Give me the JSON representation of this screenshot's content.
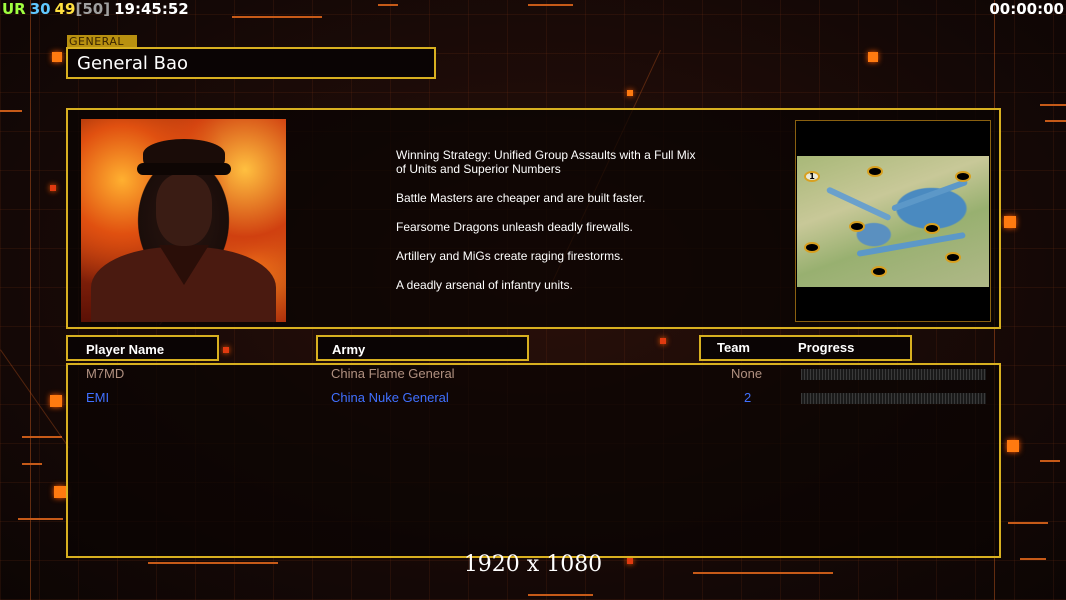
{
  "hud": {
    "left_parts": [
      {
        "text": "UR",
        "color": "#a0ff40"
      },
      {
        "text": "30",
        "color": "#60c8ff"
      },
      {
        "text": "49",
        "color": "#ffe040"
      },
      {
        "text": "[50]",
        "color": "#a0a0a0"
      },
      {
        "text": "19:45:52",
        "color": "#ffffff"
      }
    ],
    "timer": "00:00:00"
  },
  "general": {
    "tag": "GENERAL",
    "name": "General Bao"
  },
  "strategy_lines": [
    "Winning Strategy: Unified Group Assaults with a Full Mix of Units and Superior Numbers",
    "Battle Masters are cheaper and are built faster.",
    "Fearsome Dragons unleash deadly firewalls.",
    "Artillery and MiGs create raging firestorms.",
    "A deadly arsenal of infantry units."
  ],
  "map": {
    "player_marker": "1"
  },
  "columns": {
    "player_name": "Player Name",
    "army": "Army",
    "team": "Team",
    "progress": "Progress"
  },
  "players": [
    {
      "name": "M7MD",
      "army": "China Flame General",
      "team": "None",
      "color": "#b09080"
    },
    {
      "name": "EMI",
      "army": "China Nuke General",
      "team": "2",
      "color": "#4070ff"
    }
  ],
  "resolution": "1920 x 1080",
  "colors": {
    "accent_yellow": "#d8b020",
    "bg_dark": "#120806",
    "deco_orange": "#ff7a10"
  }
}
